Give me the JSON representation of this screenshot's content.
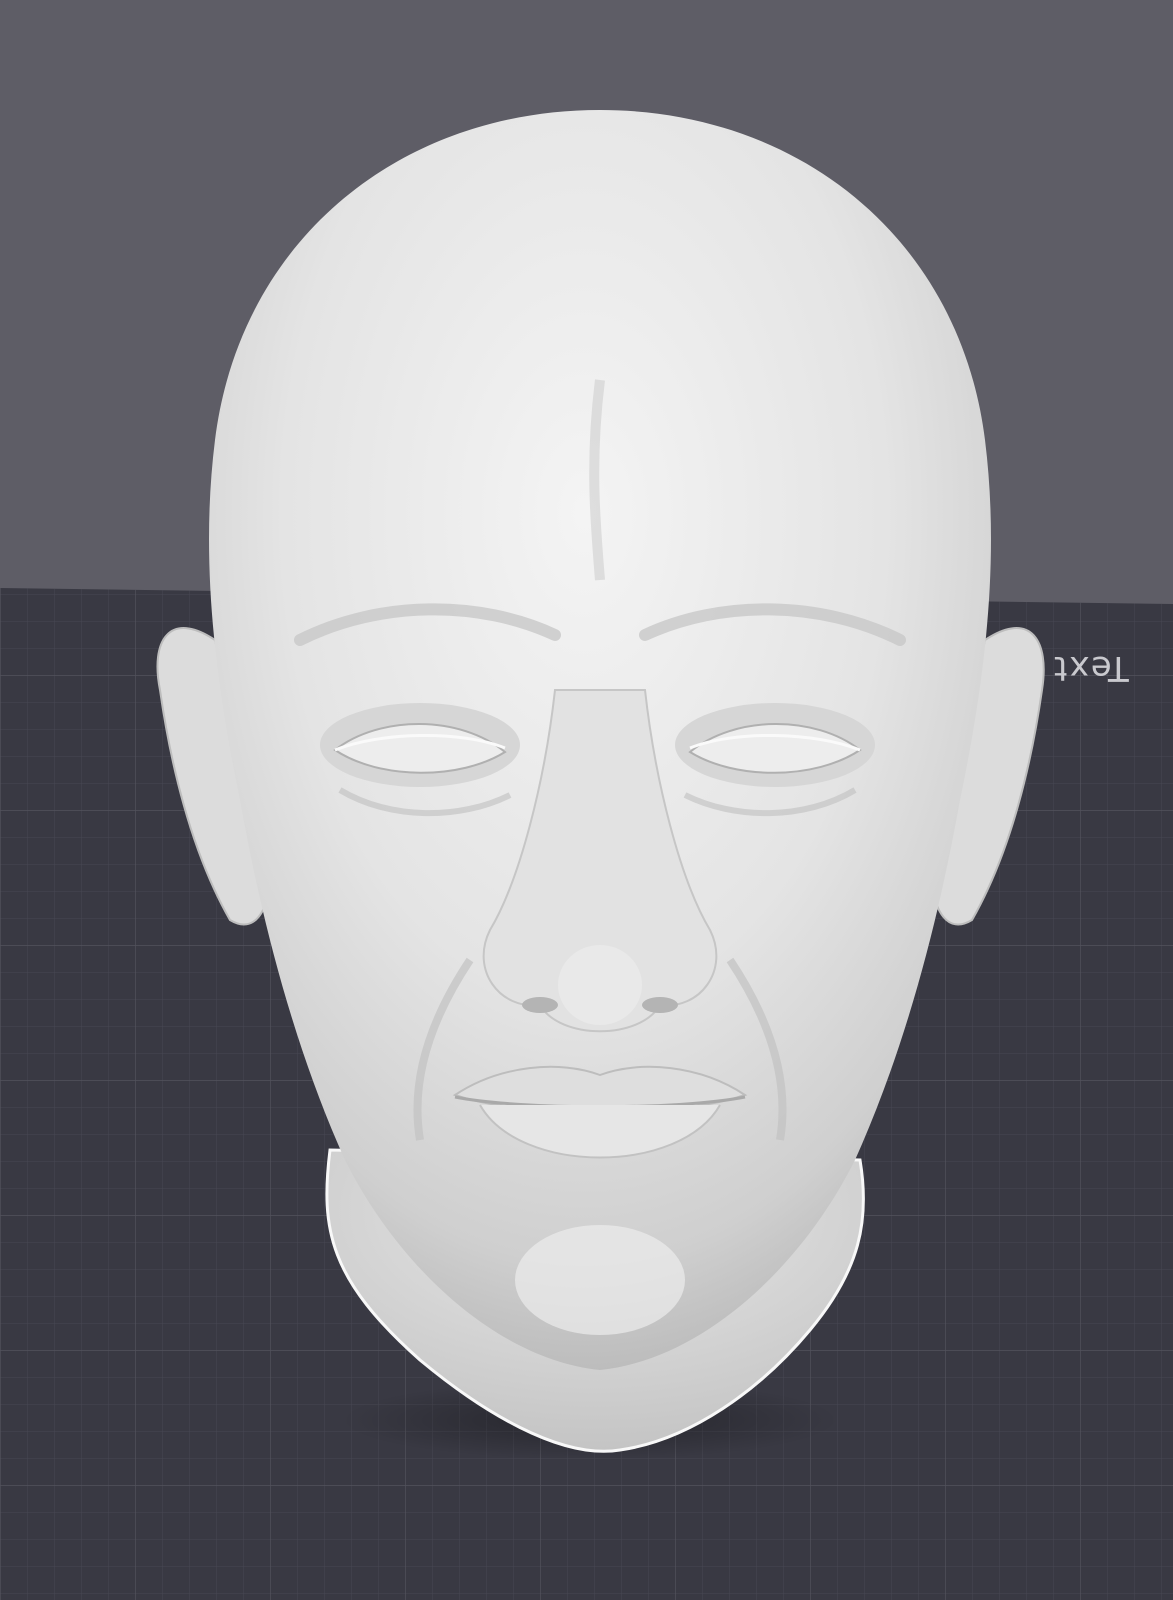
{
  "viewport": {
    "background_color": "#5e5d66",
    "build_plate_color": "#393943",
    "grid_line_color": "#50505c",
    "model_color": "#ececec"
  },
  "build_plate": {
    "label": "Text"
  },
  "model": {
    "icon": "sculpted-head-model"
  }
}
